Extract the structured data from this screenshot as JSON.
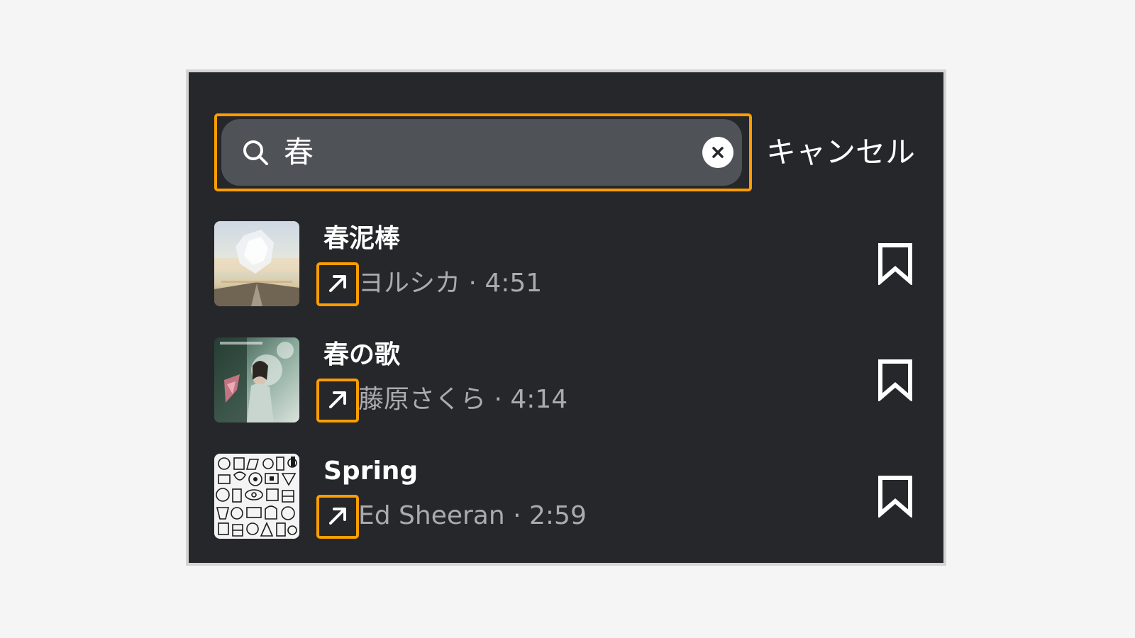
{
  "search": {
    "query": "春",
    "cancel_label": "キャンセル",
    "search_icon": "search-icon",
    "clear_icon": "clear-circle-x-icon"
  },
  "results": [
    {
      "title": "春泥棒",
      "artist": "ヨルシカ",
      "duration": "4:51",
      "meta": "ヨルシカ · 4:51",
      "arrow_icon": "arrow-up-right-icon",
      "bookmark_icon": "bookmark-icon"
    },
    {
      "title": "春の歌",
      "artist": "藤原さくら",
      "duration": "4:14",
      "meta": "藤原さくら · 4:14",
      "arrow_icon": "arrow-up-right-icon",
      "bookmark_icon": "bookmark-icon"
    },
    {
      "title": "Spring",
      "artist": "Ed Sheeran",
      "duration": "2:59",
      "meta": "Ed Sheeran · 2:59",
      "arrow_icon": "arrow-up-right-icon",
      "bookmark_icon": "bookmark-icon"
    }
  ],
  "colors": {
    "background": "#25272b",
    "search_field": "#4f5256",
    "highlight": "#ff9d00",
    "secondary_text": "#a9abb0"
  }
}
